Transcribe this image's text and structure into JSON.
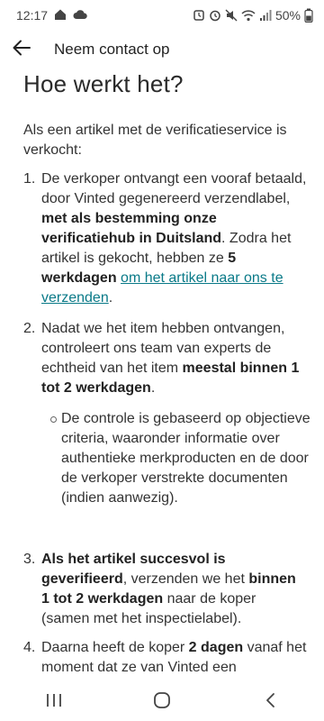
{
  "status_bar": {
    "time": "12:17",
    "battery": "50%"
  },
  "app_bar": {
    "title": "Neem contact op"
  },
  "content": {
    "heading": "Hoe werkt het?",
    "intro": "Als een artikel met de verificatieservice is verkocht:",
    "steps": [
      {
        "num": "1.",
        "p1": "De verkoper ontvangt een vooraf betaald, door Vinted gegenereerd verzendlabel, ",
        "b1": "met als bestemming onze verificatiehub in Duitsland",
        "p2": ". Zodra het artikel is gekocht, hebben ze ",
        "b2": "5 werkdagen",
        "p3": " ",
        "link": "om het artikel naar ons te verzenden",
        "p4": "."
      },
      {
        "num": "2.",
        "p1": "Nadat we het item hebben ontvangen, controleert ons team van experts de echtheid van het item ",
        "b1": "meestal binnen 1 tot 2 werkdagen",
        "p2": ".",
        "bullet": "De controle is gebaseerd op objectieve criteria, waaronder informatie over authentieke merkproducten en de door de verkoper verstrekte documenten (indien aanwezig)."
      },
      {
        "num": "3.",
        "b1": "Als het artikel succesvol is geverifieerd",
        "p1": ", verzenden we het ",
        "b2": "binnen 1 tot 2 werkdagen",
        "p2": " naar de koper (samen met het inspectielabel)."
      },
      {
        "num": "4.",
        "p1": "Daarna heeft de koper ",
        "b1": "2 dagen",
        "p2": " vanaf het moment dat ze van Vinted een"
      }
    ]
  },
  "nav": {
    "recents": "recent-apps",
    "home": "home",
    "back": "back"
  }
}
